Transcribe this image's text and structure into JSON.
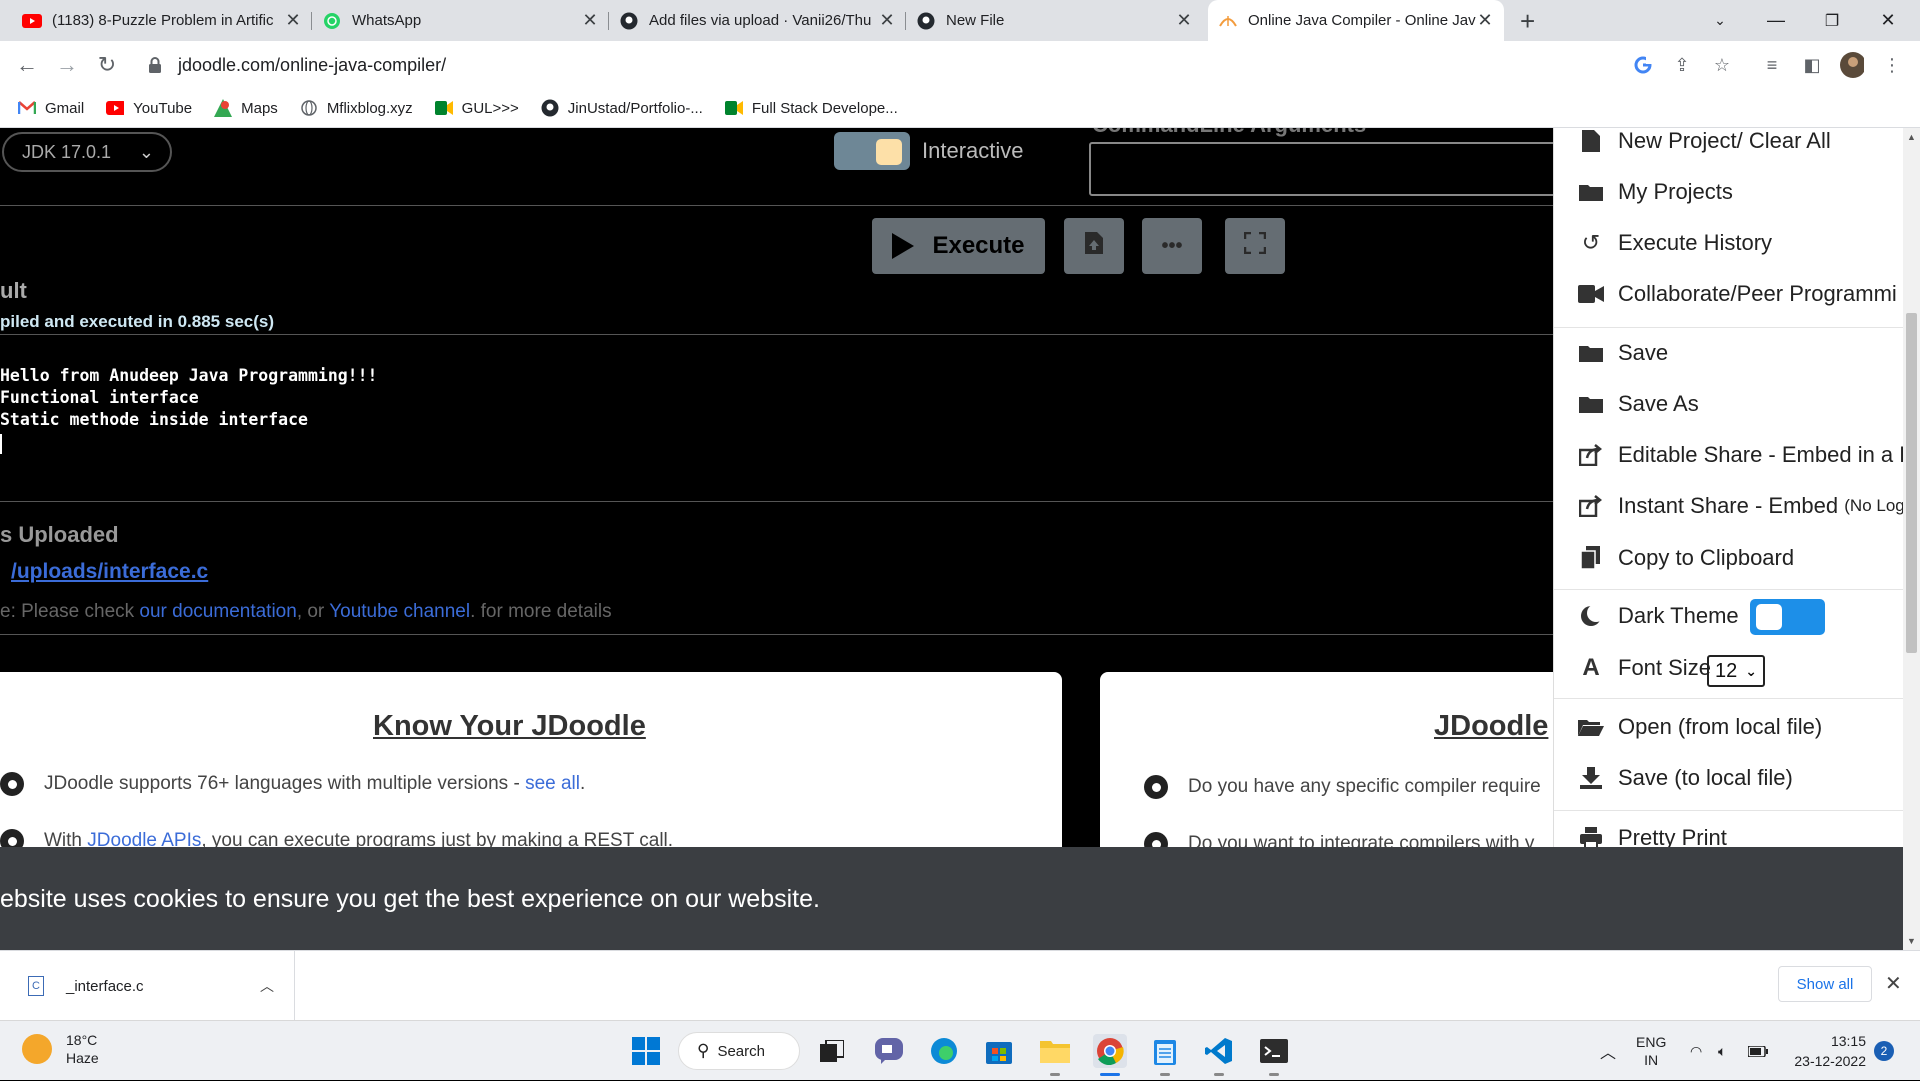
{
  "browser": {
    "tabs": [
      {
        "title": "(1183) 8-Puzzle Problem in Artific",
        "icon": "youtube-icon"
      },
      {
        "title": "WhatsApp",
        "icon": "whatsapp-icon"
      },
      {
        "title": "Add files via upload · Vanii26/Thu",
        "icon": "github-icon"
      },
      {
        "title": "New File",
        "icon": "github-icon"
      },
      {
        "title": "Online Java Compiler - Online Jav",
        "icon": "jdoodle-icon",
        "active": true
      }
    ],
    "url": "jdoodle.com/online-java-compiler/",
    "bookmarks": [
      {
        "label": "Gmail",
        "icon": "gmail-icon"
      },
      {
        "label": "YouTube",
        "icon": "youtube-icon"
      },
      {
        "label": "Maps",
        "icon": "maps-icon"
      },
      {
        "label": "Mflixblog.xyz",
        "icon": "globe-icon"
      },
      {
        "label": "GUL>>>",
        "icon": "meet-icon"
      },
      {
        "label": "JinUstad/Portfolio-...",
        "icon": "github-icon"
      },
      {
        "label": "Full Stack Develope...",
        "icon": "meet-icon"
      }
    ]
  },
  "editor": {
    "jdk_version": "JDK 17.0.1",
    "interactive_label": "Interactive",
    "args_label": "CommandLine Arguments",
    "execute_label": "Execute",
    "more_label": "•••",
    "result_title": "ult",
    "compiled_msg": "piled and executed in 0.885 sec(s)",
    "output_lines": [
      "Hello  from Anudeep Java Programming!!!",
      "Functional interface",
      "Static methode inside interface"
    ],
    "uploaded_title": "s Uploaded",
    "upload_link": "/uploads/interface.c",
    "note_prefix": "e: Please check ",
    "note_link1": "our documentation",
    "note_mid": ", or ",
    "note_link2": "Youtube channel",
    "note_suffix": ". for more details"
  },
  "cards": {
    "left": {
      "title": "Know Your JDoodle",
      "b1_text": "JDoodle supports 76+ languages with multiple versions - ",
      "b1_link": "see all",
      "b1_end": ".",
      "b2_pre": "With ",
      "b2_link": "JDoodle APIs",
      "b2_text": ", you can execute programs just by making a REST call."
    },
    "right": {
      "title": "JDoodle",
      "b1_text": "Do you have any specific compiler require",
      "b2_text": "Do you want to integrate compilers with y"
    }
  },
  "cookie_text": "ebsite uses cookies to ensure you get the best experience on our website.",
  "menu": {
    "new_project": "New Project/ Clear All",
    "my_projects": "My Projects",
    "execute_history": "Execute History",
    "collaborate": "Collaborate/Peer Programmi",
    "save": "Save",
    "save_as": "Save As",
    "editable_share": "Editable Share - Embed in a E",
    "instant_share": "Instant Share - Embed",
    "instant_share_small": "(No Log",
    "copy_clipboard": "Copy to Clipboard",
    "dark_theme": "Dark Theme",
    "font_size": "Font Size",
    "font_size_value": "12",
    "open_local": "Open (from local file)",
    "save_local": "Save (to local file)",
    "pretty_print": "Pretty Print"
  },
  "download": {
    "filename": "_interface.c",
    "show_all": "Show all"
  },
  "taskbar": {
    "temp": "18°C",
    "weather": "Haze",
    "search": "Search",
    "lang1": "ENG",
    "lang2": "IN",
    "time": "13:15",
    "date": "23-12-2022",
    "notif_count": "2"
  },
  "colors": {
    "link": "#3b6cd8",
    "toggle_on": "#1d8fe8",
    "cookie_bg": "#3b3e42"
  }
}
